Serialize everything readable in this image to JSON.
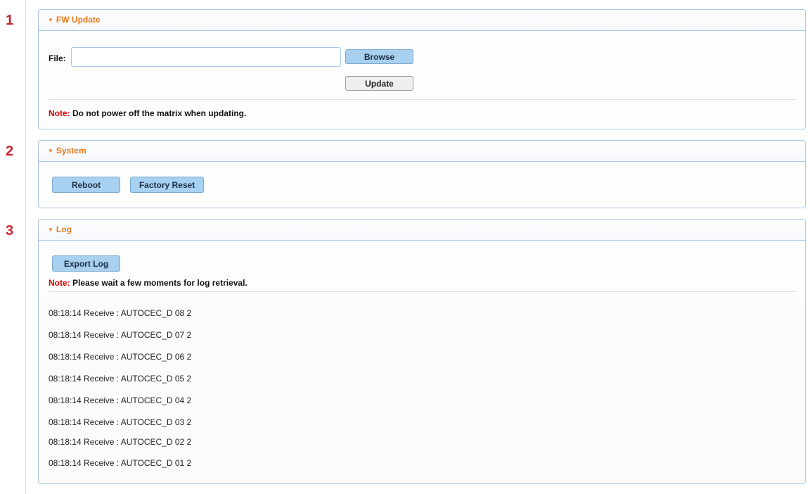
{
  "steps": [
    "1",
    "2",
    "3"
  ],
  "fw_update": {
    "title": "FW Update",
    "file_label": "File:",
    "file_value": "",
    "browse_label": "Browse",
    "update_label": "Update",
    "note_prefix": "Note:",
    "note_text": " Do not power off the matrix when updating."
  },
  "system": {
    "title": "System",
    "reboot_label": "Reboot",
    "factory_reset_label": "Factory Reset"
  },
  "log": {
    "title": "Log",
    "export_label": "Export Log",
    "note_prefix": "Note:",
    "note_text": " Please wait a few moments for log retrieval.",
    "lines": [
      "08:18:14 Receive : AUTOCEC_D 08 2",
      "08:18:14 Receive : AUTOCEC_D 07 2",
      "08:18:14 Receive : AUTOCEC_D 06 2",
      "08:18:14 Receive : AUTOCEC_D 05 2",
      "08:18:14 Receive : AUTOCEC_D 04 2",
      "08:18:14 Receive : AUTOCEC_D 03 2",
      "08:18:14 Receive : AUTOCEC_D 02 2",
      "08:18:14 Receive : AUTOCEC_D 01 2"
    ]
  },
  "colors": {
    "accent_orange": "#e8791a",
    "note_red": "#e00000",
    "panel_border": "#a9c7e8",
    "button_blue": "#a8d0f0",
    "step_red": "#c8232c"
  }
}
